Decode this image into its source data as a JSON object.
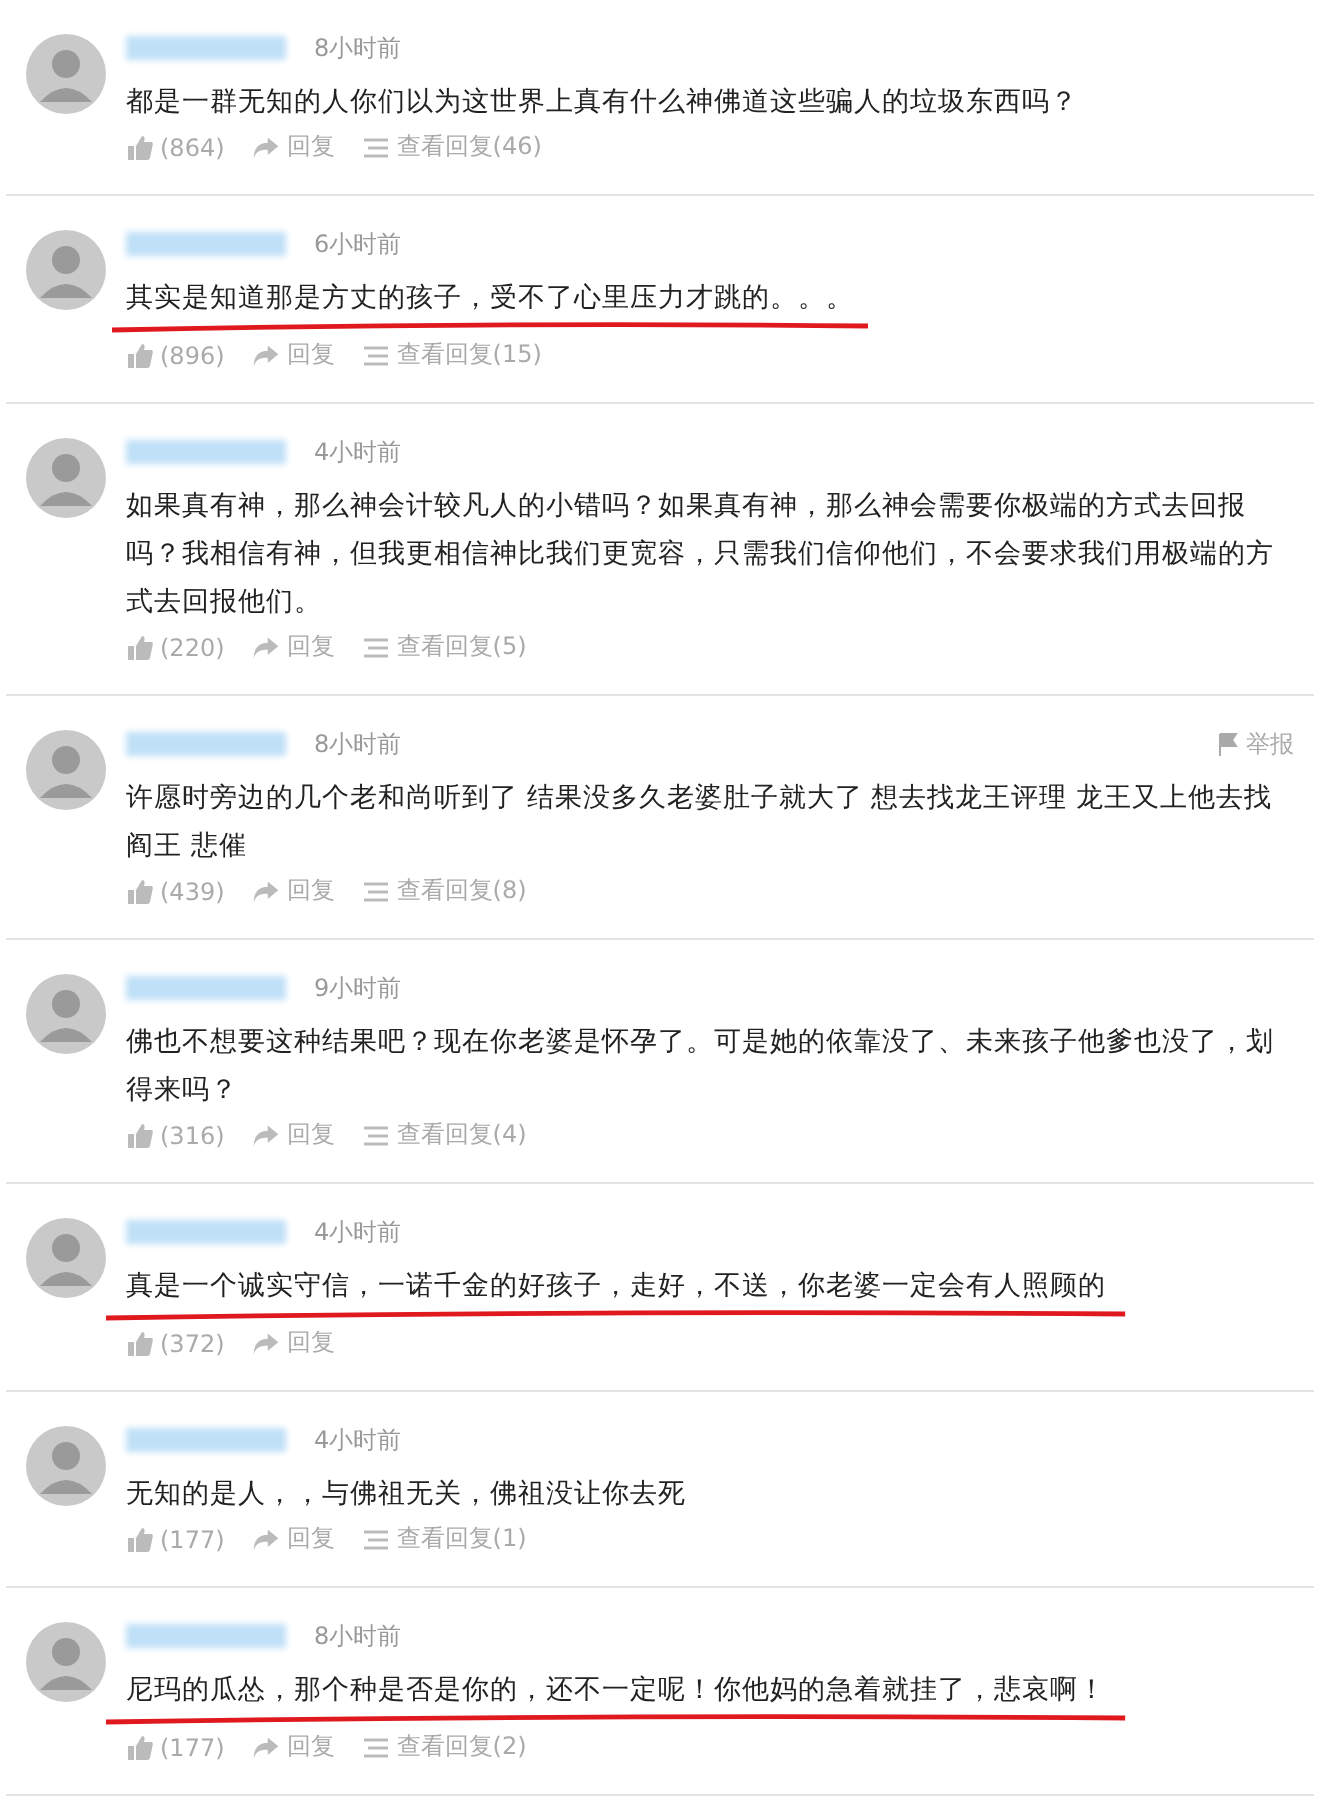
{
  "comments": [
    {
      "time": "8小时前",
      "text": "都是一群无知的人你们以为这世界上真有什么神佛道这些骗人的垃圾东西吗？",
      "underlined": false,
      "likes": "(864)",
      "reply": "回复",
      "view_replies": "查看回复(46)"
    },
    {
      "time": "6小时前",
      "text": "其实是知道那是方丈的孩子，受不了心里压力才跳的。。。",
      "underlined": true,
      "likes": "(896)",
      "reply": "回复",
      "view_replies": "查看回复(15)"
    },
    {
      "time": "4小时前",
      "text": "如果真有神，那么神会计较凡人的小错吗？如果真有神，那么神会需要你极端的方式去回报吗？我相信有神，但我更相信神比我们更宽容，只需我们信仰他们，不会要求我们用极端的方式去回报他们。",
      "underlined": false,
      "likes": "(220)",
      "reply": "回复",
      "view_replies": "查看回复(5)"
    },
    {
      "time": "8小时前",
      "report": "举报",
      "text": "许愿时旁边的几个老和尚听到了  结果没多久老婆肚子就大了  想去找龙王评理  龙王又上他去找阎王  悲催",
      "underlined": false,
      "likes": "(439)",
      "reply": "回复",
      "view_replies": "查看回复(8)"
    },
    {
      "time": "9小时前",
      "text": "佛也不想要这种结果吧？现在你老婆是怀孕了。可是她的依靠没了、未来孩子他爹也没了，划得来吗？",
      "underlined": false,
      "likes": "(316)",
      "reply": "回复",
      "view_replies": "查看回复(4)"
    },
    {
      "time": "4小时前",
      "text": "真是一个诚实守信，一诺千金的好孩子，走好，不送，你老婆一定会有人照顾的",
      "underlined": true,
      "likes": "(372)",
      "reply": "回复"
    },
    {
      "time": "4小时前",
      "text": "无知的是人，，与佛祖无关，佛祖没让你去死",
      "underlined": false,
      "likes": "(177)",
      "reply": "回复",
      "view_replies": "查看回复(1)"
    },
    {
      "time": "8小时前",
      "text": "尼玛的瓜怂，那个种是否是你的，还不一定呢！你他妈的急着就挂了，悲哀啊！",
      "underlined": true,
      "likes": "(177)",
      "reply": "回复",
      "view_replies": "查看回复(2)"
    }
  ]
}
